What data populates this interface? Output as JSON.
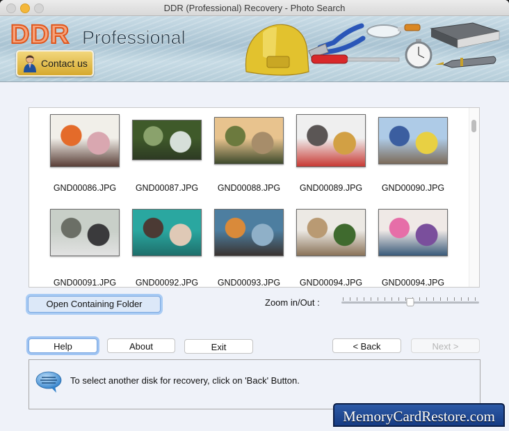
{
  "window": {
    "title": "DDR (Professional) Recovery - Photo Search"
  },
  "banner": {
    "brand_main": "DDR",
    "brand_sub": "Professional",
    "contact_label": "Contact us",
    "tool_icons": [
      "hard-hat-icon",
      "pliers-icon",
      "magnifier-icon",
      "book-icon",
      "screwdriver-icon",
      "stopwatch-icon",
      "fountain-pen-icon"
    ]
  },
  "gallery": {
    "items": [
      {
        "filename": "GND00086.JPG",
        "palette": [
          "#f1efe9",
          "#e46b2a",
          "#d9a7b0",
          "#5a3f38"
        ]
      },
      {
        "filename": "GND00087.JPG",
        "palette": [
          "#3f5a2a",
          "#8aa26c",
          "#d6dfd9",
          "#2d3a23"
        ]
      },
      {
        "filename": "GND00088.JPG",
        "palette": [
          "#e8c38e",
          "#6c7a3e",
          "#a78d6a",
          "#3e4a2c"
        ]
      },
      {
        "filename": "GND00089.JPG",
        "palette": [
          "#efefef",
          "#5b5655",
          "#d2a044",
          "#c83a34"
        ]
      },
      {
        "filename": "GND00090.JPG",
        "palette": [
          "#aecbe7",
          "#3b5ea0",
          "#e8d043",
          "#7c6b5a"
        ]
      },
      {
        "filename": "GND00091.JPG",
        "palette": [
          "#c8cfc8",
          "#6b6f66",
          "#3a3a3c",
          "#e2e2e2"
        ]
      },
      {
        "filename": "GND00092.JPG",
        "palette": [
          "#2aa7a0",
          "#4b3a34",
          "#dfc9b6",
          "#1e6f6b"
        ]
      },
      {
        "filename": "GND00093.JPG",
        "palette": [
          "#4d7ea0",
          "#d98a3a",
          "#8fb0c8",
          "#3a3330"
        ]
      },
      {
        "filename": "GND00094.JPG",
        "palette": [
          "#ece9e4",
          "#b99a73",
          "#3f6a2e",
          "#8a7358"
        ]
      },
      {
        "filename": "GND00094.JPG",
        "palette": [
          "#efe9e6",
          "#e66ea8",
          "#7a4f9c",
          "#3a5a7a"
        ]
      }
    ]
  },
  "actions": {
    "open_folder_label": "Open Containing Folder",
    "zoom_label": "Zoom in/Out :",
    "zoom_value": 0.5,
    "help_label": "Help",
    "about_label": "About",
    "exit_label": "Exit",
    "back_label": "< Back",
    "next_label": "Next >"
  },
  "message": {
    "text": "To select another disk for recovery, click on 'Back' Button."
  },
  "watermark": {
    "text": "MemoryCardRestore.com"
  }
}
